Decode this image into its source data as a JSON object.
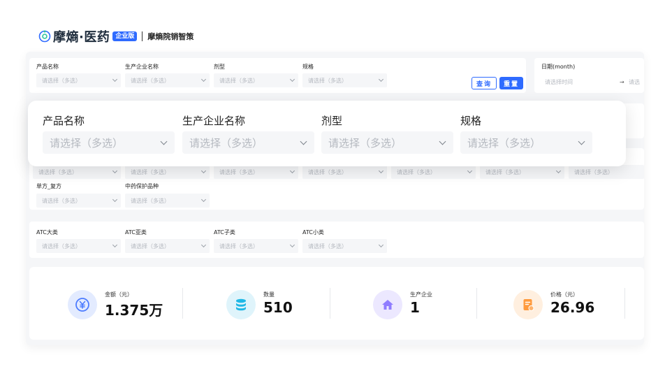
{
  "brand": {
    "name": "摩熵·医药",
    "edition": "企业版",
    "product": "摩熵院销智策"
  },
  "filters_row1": {
    "product_name": {
      "label": "产品名称",
      "placeholder": "请选择（多选）"
    },
    "manufacturer": {
      "label": "生产企业名称",
      "placeholder": "请选择（多选）"
    },
    "dosage_form": {
      "label": "剂型",
      "placeholder": "请选择（多选）"
    },
    "spec": {
      "label": "规格",
      "placeholder": "请选择（多选）"
    },
    "query_label": "查询",
    "reset_label": "重置",
    "date": {
      "label": "日期(month)",
      "placeholder": "请选择时间",
      "arrow": "→",
      "end_placeholder": "请选"
    }
  },
  "filters_row3": {
    "placeholders": [
      "请选择（多选）",
      "请选择（多选）",
      "请选择（多选）",
      "请选择（多选）",
      "请选择（多选）",
      "请选择（多选）",
      "请选择（多选）"
    ],
    "single_compound": {
      "label": "单方_复方",
      "placeholder": "请选择（多选）"
    },
    "tcm_protected": {
      "label": "中药保护品种",
      "placeholder": "请选择（多选）"
    }
  },
  "filters_atc": {
    "atc1": {
      "label": "ATC大类",
      "placeholder": "请选择（多选）"
    },
    "atc2": {
      "label": "ATC亚类",
      "placeholder": "请选择（多选）"
    },
    "atc3": {
      "label": "ATC子类",
      "placeholder": "请选择（多选）"
    },
    "atc4": {
      "label": "ATC小类",
      "placeholder": "请选择（多选）"
    }
  },
  "zoom": {
    "product_name": {
      "label": "产品名称",
      "placeholder": "请选择（多选）"
    },
    "manufacturer": {
      "label": "生产企业名称",
      "placeholder": "请选择（多选）"
    },
    "dosage_form": {
      "label": "剂型",
      "placeholder": "请选择（多选）"
    },
    "spec": {
      "label": "规格",
      "placeholder": "请选择（多选）"
    }
  },
  "stats": [
    {
      "label": "金额（元）",
      "value": "1.375万",
      "icon": "yuan-icon",
      "color": "#4d7cff",
      "bg": "#e3ebff"
    },
    {
      "label": "数量",
      "value": "510",
      "icon": "database-icon",
      "color": "#1fb8e6",
      "bg": "#dff4fb"
    },
    {
      "label": "生产企业",
      "value": "1",
      "icon": "home-icon",
      "color": "#8f7cff",
      "bg": "#ece8ff"
    },
    {
      "label": "价格（元）",
      "value": "26.96",
      "icon": "document-icon",
      "color": "#ff9a3c",
      "bg": "#ffefdf"
    }
  ]
}
